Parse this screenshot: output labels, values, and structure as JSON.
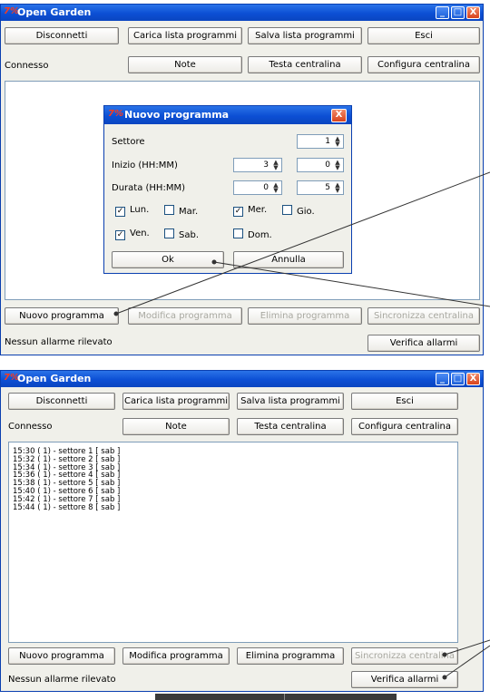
{
  "app": {
    "title": "Open Garden",
    "logo_text": "7%"
  },
  "titlebar_buttons": {
    "minimize": "_",
    "maximize": "□",
    "close": "X"
  },
  "toolbar": {
    "disconnect": "Disconnetti",
    "load_list": "Carica lista programmi",
    "save_list": "Salva lista programmi",
    "exit": "Esci",
    "status": "Connesso",
    "notes": "Note",
    "test_unit": "Testa centralina",
    "configure_unit": "Configura centralina"
  },
  "bottom": {
    "new_program": "Nuovo programma",
    "edit_program": "Modifica programma",
    "delete_program": "Elimina programma",
    "sync_unit": "Sincronizza centralina",
    "alarm_status": "Nessun allarme rilevato",
    "check_alarms": "Verifica allarmi"
  },
  "dialog": {
    "title": "Nuovo programma",
    "sector_label": "Settore",
    "sector_value": "1",
    "start_label": "Inizio (HH:MM)",
    "start_hh": "3",
    "start_mm": "0",
    "duration_label": "Durata (HH:MM)",
    "duration_hh": "0",
    "duration_mm": "5",
    "days": [
      {
        "label": "Lun.",
        "checked": true
      },
      {
        "label": "Mar.",
        "checked": false
      },
      {
        "label": "Mer.",
        "checked": true
      },
      {
        "label": "Gio.",
        "checked": false
      },
      {
        "label": "Ven.",
        "checked": true
      },
      {
        "label": "Sab.",
        "checked": false
      },
      {
        "label": "Dom.",
        "checked": false
      }
    ],
    "ok": "Ok",
    "cancel": "Annulla"
  },
  "program_list": [
    "15:30 ( 1) - settore 1 [ sab ]",
    "15:32 ( 1) - settore 2 [ sab ]",
    "15:34 ( 1) - settore 3 [ sab ]",
    "15:36 ( 1) - settore 4 [ sab ]",
    "15:38 ( 1) - settore 5 [ sab ]",
    "15:40 ( 1) - settore 6 [ sab ]",
    "15:42 ( 1) - settore 7 [ sab ]",
    "15:44 ( 1) - settore 8 [ sab ]"
  ]
}
